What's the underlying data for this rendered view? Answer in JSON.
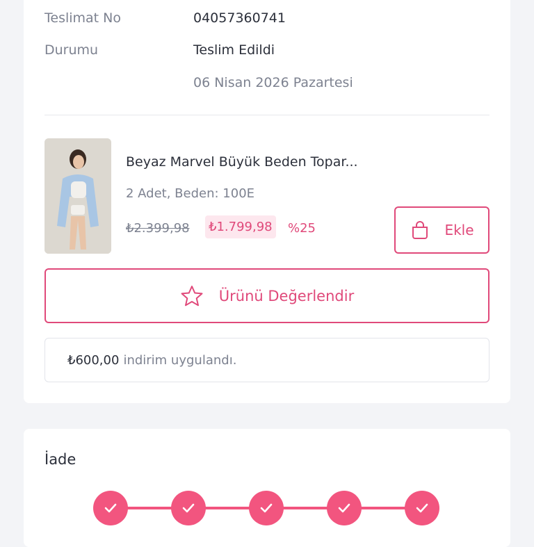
{
  "delivery": {
    "number_label": "Teslimat No",
    "number_value": "04057360741",
    "status_label": "Durumu",
    "status_value": "Teslim Edildi",
    "date": "06 Nisan 2026 Pazartesi"
  },
  "product": {
    "name": "Beyaz Marvel Büyük Beden Topar...",
    "meta": "2 Adet, Beden: 100E",
    "price_old": "₺2.399,98",
    "price_new": "₺1.799,98",
    "discount_percent": "%25",
    "add_label": "Ekle",
    "image_icon": "product-photo"
  },
  "review": {
    "label": "Ürünü Değerlendir",
    "icon": "star-outline-icon"
  },
  "discount_note": {
    "amount": "₺600,00",
    "text": "indirim uygulandı."
  },
  "return_section": {
    "title": "İade",
    "steps": [
      {
        "status": "completed"
      },
      {
        "status": "completed"
      },
      {
        "status": "completed"
      },
      {
        "status": "completed"
      },
      {
        "status": "completed"
      }
    ]
  },
  "colors": {
    "accent": "#e0497a",
    "step": "#f2557f",
    "price_bg": "#fde7ee",
    "muted_text": "#7d8290",
    "background": "#f3f4f7"
  }
}
